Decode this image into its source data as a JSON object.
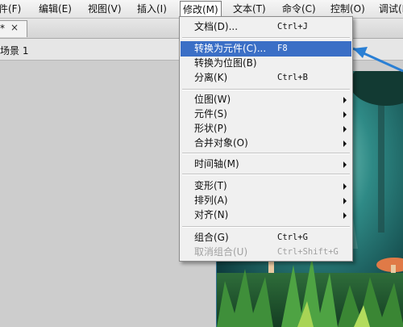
{
  "menubar": {
    "items": [
      {
        "label": "件(F)"
      },
      {
        "label": "编辑(E)"
      },
      {
        "label": "视图(V)"
      },
      {
        "label": "插入(I)"
      },
      {
        "label": "修改(M)"
      },
      {
        "label": "文本(T)"
      },
      {
        "label": "命令(C)"
      },
      {
        "label": "控制(O)"
      },
      {
        "label": "调试(D)"
      }
    ]
  },
  "tab": {
    "star": "*",
    "close": "×"
  },
  "scene": {
    "label": "场景 1"
  },
  "modify_menu": {
    "items": [
      {
        "label": "文档(D)...",
        "shortcut": "Ctrl+J"
      },
      {
        "label": "转换为元件(C)...",
        "shortcut": "F8"
      },
      {
        "label": "转换为位图(B)",
        "shortcut": ""
      },
      {
        "label": "分离(K)",
        "shortcut": "Ctrl+B"
      },
      {
        "label": "位图(W)"
      },
      {
        "label": "元件(S)"
      },
      {
        "label": "形状(P)"
      },
      {
        "label": "合并对象(O)"
      },
      {
        "label": "时间轴(M)"
      },
      {
        "label": "变形(T)"
      },
      {
        "label": "排列(A)"
      },
      {
        "label": "对齐(N)"
      },
      {
        "label": "组合(G)",
        "shortcut": "Ctrl+G"
      },
      {
        "label": "取消组合(U)",
        "shortcut": "Ctrl+Shift+G"
      }
    ]
  },
  "colors": {
    "highlight": "#3b6fc6",
    "annotation_arrow": "#2a7fd4"
  }
}
